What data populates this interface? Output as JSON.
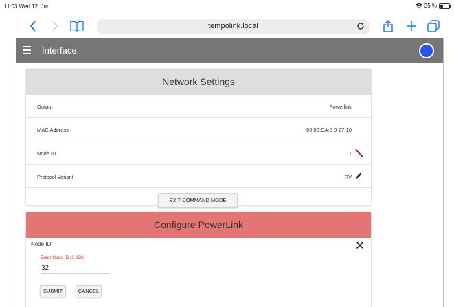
{
  "status_bar": {
    "time_date": "11:03  Wed 12. Jun",
    "battery_text": "35 %",
    "battery_level": 0.35
  },
  "browser": {
    "url": "tempolink.local"
  },
  "app_bar": {
    "title": "Interface"
  },
  "network_settings": {
    "title": "Network Settings",
    "rows": [
      {
        "label": "Output",
        "value": "Powerlink",
        "icon": null
      },
      {
        "label": "MAC Address",
        "value": "00:03:CA:0-0-27-10",
        "icon": null
      },
      {
        "label": "Node ID",
        "value": "1",
        "icon": "edit-pencil-red-icon"
      },
      {
        "label": "Protocol Variant",
        "value": "RV",
        "icon": "edit-pencil-icon"
      }
    ],
    "exit_button": "EXIT COMMAND MODE"
  },
  "configure": {
    "title": "Configure PowerLink",
    "subtitle": "Node ID",
    "field_label": "Enter Node ID (1-239)",
    "field_value": "32",
    "submit_label": "SUBMIT",
    "cancel_label": "CANCEL"
  },
  "colors": {
    "accent_blue": "#0a7aff",
    "app_bar": "#767676",
    "configure_header": "#e47575",
    "card_header": "#dedede",
    "status_dot": "#2455f2",
    "field_label": "#c0392b"
  }
}
